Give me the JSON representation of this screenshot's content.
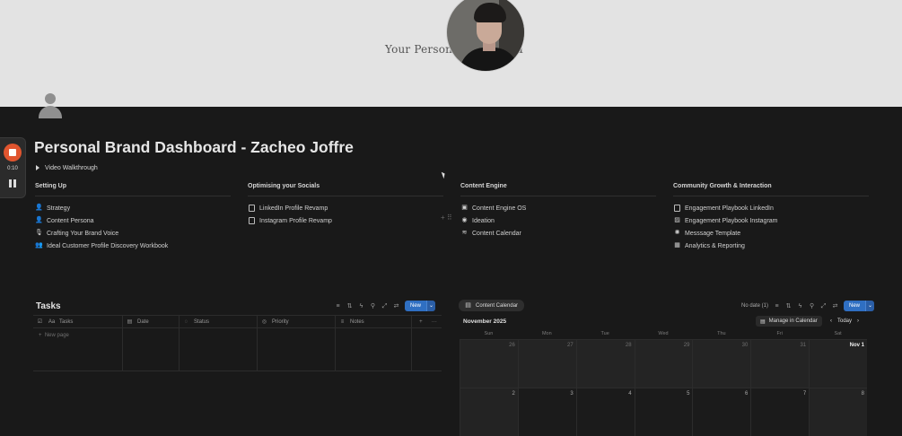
{
  "cover": {
    "title_left": "Your Personal B",
    "title_right": "d"
  },
  "recorder": {
    "time": "0:10"
  },
  "page": {
    "title": "Personal Brand Dashboard - Zacheo Joffre",
    "toggle": "Video Walkthrough"
  },
  "columns": [
    {
      "heading": "Setting Up",
      "items": [
        {
          "icon": "person-icon",
          "label": "Strategy"
        },
        {
          "icon": "person-icon",
          "label": "Content Persona"
        },
        {
          "icon": "microphone-icon",
          "label": "Crafting Your Brand Voice"
        },
        {
          "icon": "group-icon",
          "label": "Ideal Customer Profile Discovery Workbook"
        }
      ]
    },
    {
      "heading": "Optimising your Socials",
      "items": [
        {
          "icon": "document-icon",
          "label": "LinkedIn Profile Revamp"
        },
        {
          "icon": "document-icon",
          "label": "Instagram Profile Revamp"
        }
      ]
    },
    {
      "heading": "Content Engine",
      "items": [
        {
          "icon": "inbox-icon",
          "label": "Content Engine OS"
        },
        {
          "icon": "bulb-icon",
          "label": "Ideation"
        },
        {
          "icon": "stack-icon",
          "label": "Content Calendar"
        }
      ]
    },
    {
      "heading": "Community Growth & Interaction",
      "items": [
        {
          "icon": "document-icon",
          "label": "Engagement Playbook LinkedIn"
        },
        {
          "icon": "image-icon",
          "label": "Engagement Playbook Instagram"
        },
        {
          "icon": "gear-icon",
          "label": "Messsage Template"
        },
        {
          "icon": "grid-icon",
          "label": "Analytics & Reporting"
        }
      ]
    }
  ],
  "tasks": {
    "title": "Tasks",
    "new_label": "New",
    "columns": [
      "Tasks",
      "Date",
      "Status",
      "Priority",
      "Notes"
    ],
    "new_page": "New page"
  },
  "calendar": {
    "tab": "Content Calendar",
    "no_date": "No date (1)",
    "new_label": "New",
    "month": "November 2025",
    "manage": "Manage in Calendar",
    "today": "Today",
    "days": [
      "Sun",
      "Mon",
      "Tue",
      "Wed",
      "Thu",
      "Fri",
      "Sat"
    ],
    "weeks": [
      [
        "26",
        "27",
        "28",
        "29",
        "30",
        "31",
        "Nov 1"
      ],
      [
        "2",
        "3",
        "4",
        "5",
        "6",
        "7",
        "8"
      ]
    ]
  }
}
